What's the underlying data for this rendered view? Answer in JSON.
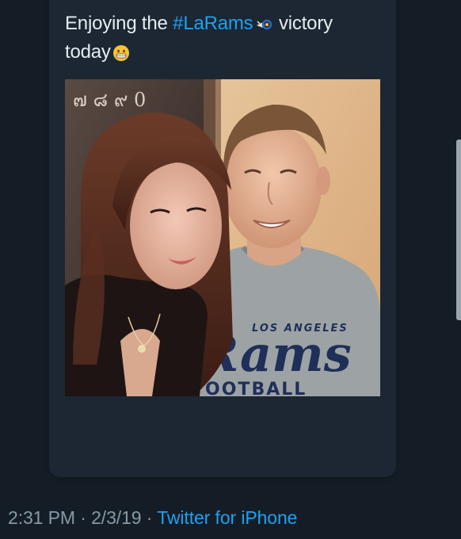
{
  "tweet": {
    "text_start": "Enjoying the ",
    "hashtag": "#LaRams",
    "text_mid": " victory",
    "text_end": "today",
    "hashtag_emoji": "ram-emoji",
    "end_emoji": "grinning-face-emoji"
  },
  "photo": {
    "shirt_line1": "LOS ANGELES",
    "shirt_line2": "Rams",
    "shirt_line3": "FOOTBALL",
    "wall_text": "๗ ๘ ๙ 0"
  },
  "meta": {
    "time": "2:31 PM",
    "sep1": " · ",
    "date": "2/3/19",
    "sep2": " · ",
    "source": "Twitter for iPhone"
  },
  "colors": {
    "background": "#141d26",
    "card": "#1c2733",
    "text": "#e6ecf0",
    "link": "#1da1f2",
    "muted": "#8899a6"
  }
}
